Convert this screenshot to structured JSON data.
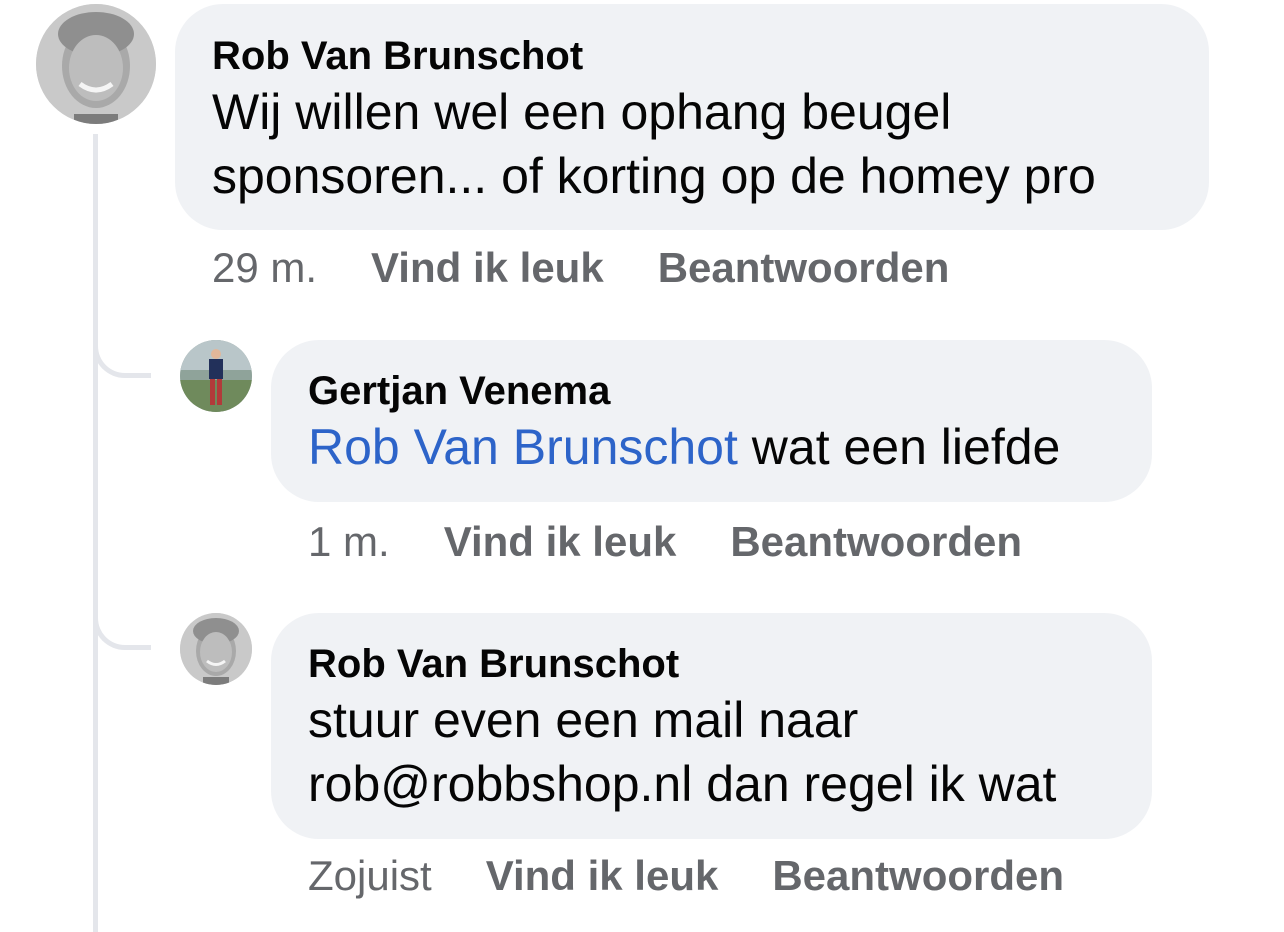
{
  "comments": [
    {
      "author": "Rob Van Brunschot",
      "text_lines": [
        "Wij willen wel een ophang beugel",
        "sponsoren... of korting op de homey pro"
      ],
      "time": "29 m.",
      "like_label": "Vind ik leuk",
      "reply_label": "Beantwoorden"
    }
  ],
  "replies": [
    {
      "author": "Gertjan Venema",
      "mention": "Rob Van Brunschot",
      "text": " wat een liefde",
      "time": "1 m.",
      "like_label": "Vind ik leuk",
      "reply_label": "Beantwoorden"
    },
    {
      "author": "Rob Van Brunschot",
      "text_lines": [
        "stuur even een mail naar",
        "rob@robbshop.nl dan regel ik wat"
      ],
      "time": "Zojuist",
      "like_label": "Vind ik leuk",
      "reply_label": "Beantwoorden"
    }
  ],
  "colors": {
    "bubble": "#f0f2f5",
    "text": "#050505",
    "meta": "#65676b",
    "mention": "#2d64c9",
    "thread_line": "#e4e6eb"
  }
}
